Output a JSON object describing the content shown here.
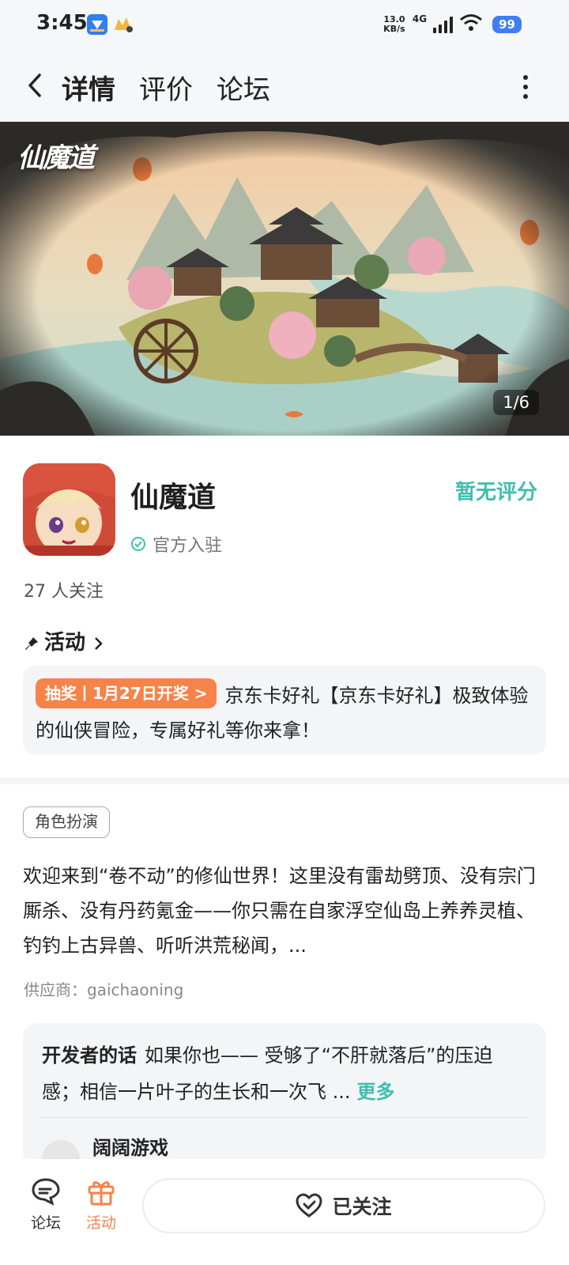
{
  "status_bar": {
    "time": "3:45",
    "net_speed_value": "13.0",
    "net_speed_unit": "KB/s",
    "network": "4G",
    "battery": "99"
  },
  "header": {
    "tabs": [
      {
        "label": "详情",
        "active": true
      },
      {
        "label": "评价",
        "active": false
      },
      {
        "label": "论坛",
        "active": false
      }
    ],
    "accent_color": "#3fc6b0"
  },
  "banner": {
    "logo_text": "仙魔道",
    "counter": "1/6"
  },
  "app": {
    "name": "仙魔道",
    "official_label": "官方入驻",
    "rating_text": "暂无评分",
    "follow_count": "27 人关注"
  },
  "activity": {
    "section_title": "活动",
    "badge": "抽奖丨1月27日开奖 >",
    "text": "京东卡好礼【京东卡好礼】极致体验的仙侠冒险，专属好礼等你来拿！",
    "badge_color": "#f6834a"
  },
  "details": {
    "tag": "角色扮演",
    "description": "欢迎来到“卷不动”的修仙世界！这里没有雷劫劈顶、没有宗门厮杀、没有丹药氪金——你只需在自家浮空仙岛上养养灵植、钓钓上古异兽、听听洪荒秘闻，...",
    "supplier": "供应商：gaichaoning"
  },
  "developer": {
    "label": "开发者的话",
    "text": "如果你也—— 受够了“不肝就落后”的压迫感；相信一片叶子的生长和一次飞 ...",
    "more": "更多",
    "name": "阔阔游戏"
  },
  "bottom_bar": {
    "forum_label": "论坛",
    "activity_label": "活动",
    "followed_label": "已关注"
  }
}
